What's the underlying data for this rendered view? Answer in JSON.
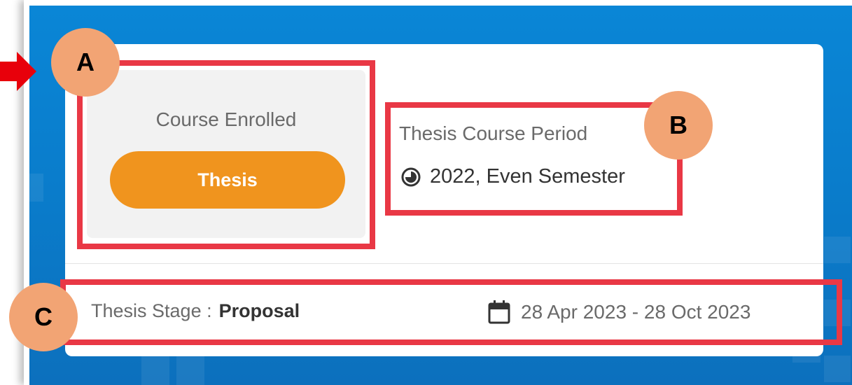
{
  "enrolled": {
    "label": "Course Enrolled",
    "course": "Thesis"
  },
  "period": {
    "label": "Thesis Course Period",
    "value": "2022, Even Semester",
    "icon": "half-circle-clock-icon"
  },
  "stage": {
    "label": "Thesis Stage :",
    "value": "Proposal"
  },
  "dates": {
    "range": "28 Apr 2023 - 28 Oct 2023",
    "icon": "calendar-icon"
  },
  "annotations": {
    "a": "A",
    "b": "B",
    "c": "C"
  },
  "colors": {
    "background": "#0a7dcc",
    "card": "#ffffff",
    "pill": "#f0941e",
    "highlight_box": "#e93845",
    "badge": "#f2a474",
    "arrow": "#e8000b"
  }
}
